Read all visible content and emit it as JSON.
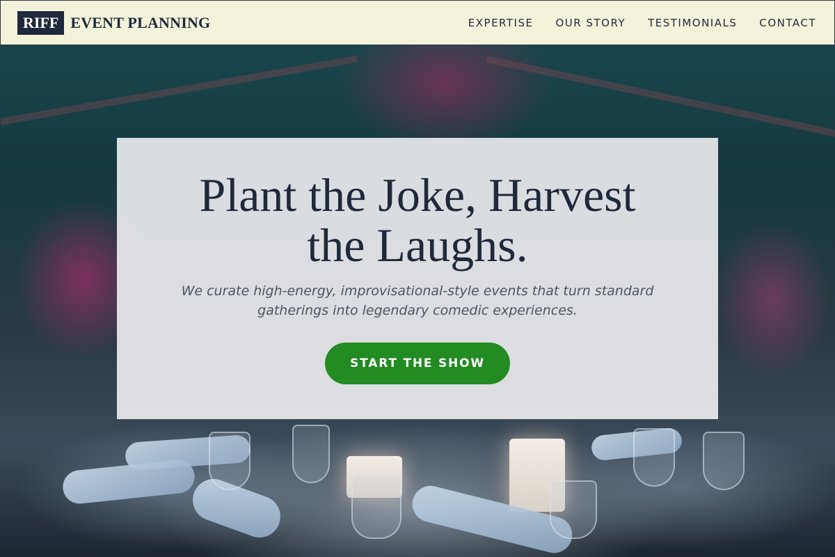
{
  "header": {
    "logo_box": "RIFF",
    "logo_text": "EVENT PLANNING",
    "nav": [
      {
        "label": "EXPERTISE"
      },
      {
        "label": "OUR STORY"
      },
      {
        "label": "TESTIMONIALS"
      },
      {
        "label": "CONTACT"
      }
    ]
  },
  "hero": {
    "title": "Plant the Joke, Harvest the Laughs.",
    "subtitle": "We curate high-energy, improvisational-style events that turn standard gatherings into legendary comedic experiences.",
    "cta_label": "START THE SHOW"
  },
  "colors": {
    "header_bg": "#f3f2da",
    "brand_dark": "#1e293b",
    "cta_green": "#228b22",
    "subtitle_gray": "#4b5563"
  },
  "background_image": "event-table-setting-photo"
}
